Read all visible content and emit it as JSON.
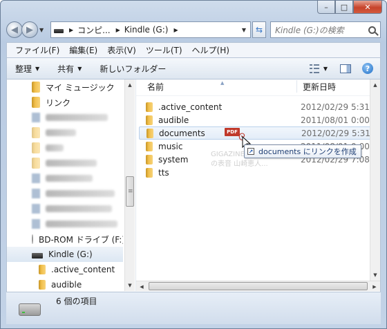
{
  "window": {
    "minimize_glyph": "–",
    "maximize_glyph": "□",
    "close_glyph": "✕"
  },
  "nav": {
    "back_icon": "back-arrow-icon",
    "forward_icon": "forward-arrow-icon",
    "breadcrumb": [
      "コンピ...",
      "Kindle (G:)"
    ],
    "search_placeholder": "Kindle (G:)の検索"
  },
  "menubar": {
    "items": [
      "ファイル(F)",
      "編集(E)",
      "表示(V)",
      "ツール(T)",
      "ヘルプ(H)"
    ]
  },
  "toolbar": {
    "organize": "整理",
    "share": "共有",
    "new_folder": "新しいフォルダー"
  },
  "navpane": {
    "items": [
      {
        "label": "マイ ミュージック",
        "icon": "music-folder-icon"
      },
      {
        "label": "リンク",
        "icon": "links-folder-icon"
      },
      {
        "label": "BD-ROM ドライブ (F:)",
        "icon": "disc-icon"
      },
      {
        "label": "Kindle (G:)",
        "icon": "drive-icon"
      },
      {
        "label": ".active_content",
        "icon": "folder-icon"
      },
      {
        "label": "audible",
        "icon": "folder-icon"
      }
    ]
  },
  "filelist": {
    "col_name": "名前",
    "col_date": "更新日時",
    "rows": [
      {
        "name": ".active_content",
        "date": "2012/02/29 5:31"
      },
      {
        "name": "audible",
        "date": "2011/08/01 0:00"
      },
      {
        "name": "documents",
        "date": "2012/02/29 5:31"
      },
      {
        "name": "music",
        "date": "2011/08/01 0:00"
      },
      {
        "name": "system",
        "date": "2012/02/29 7:08"
      },
      {
        "name": "tts",
        "date": ""
      }
    ]
  },
  "drag": {
    "badge": "PDF",
    "tooltip": "documents にリンクを作成",
    "watermark_1": "GIGAZINE...",
    "watermark_2": "の表音 山崎恵人..."
  },
  "status": {
    "text": "6 個の項目"
  }
}
